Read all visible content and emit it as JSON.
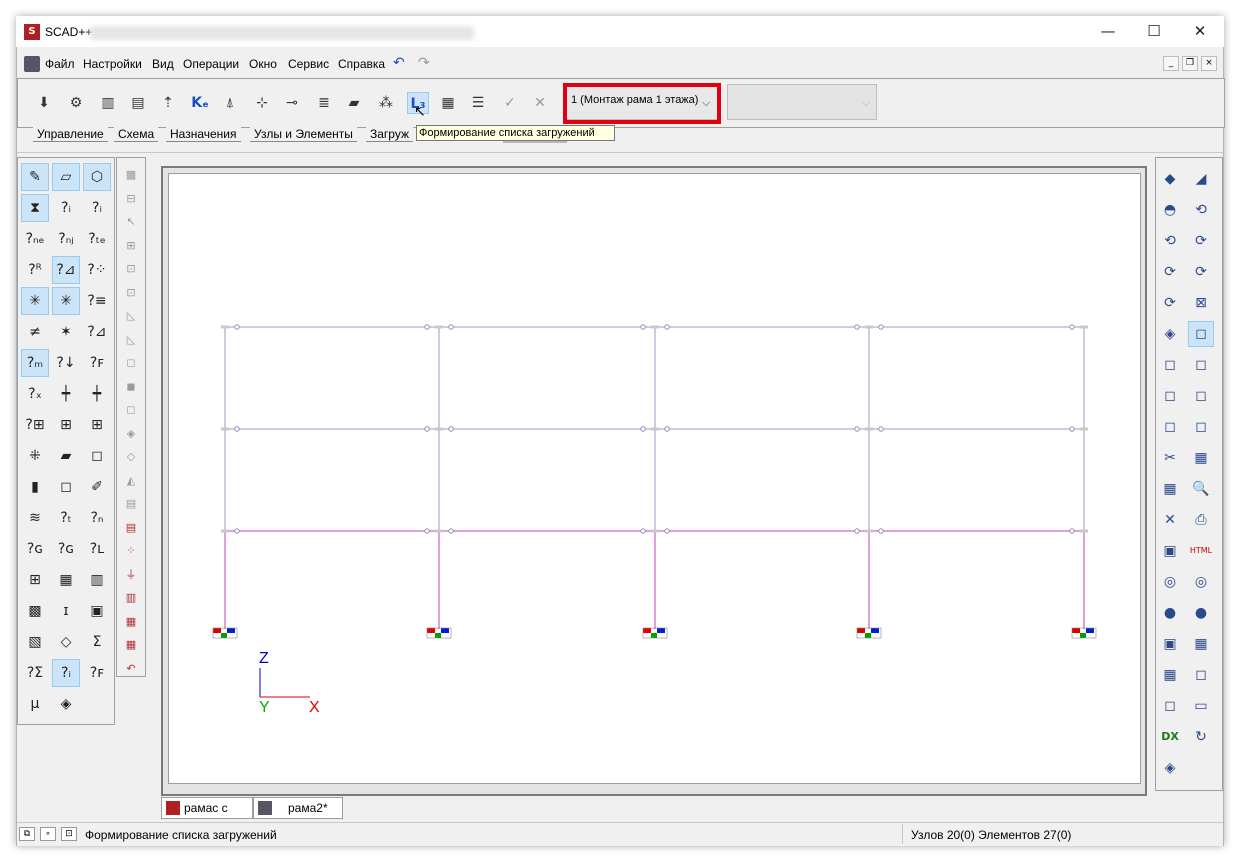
{
  "window": {
    "title": "SCAD++",
    "minimize_glyph": "—",
    "maximize_glyph": "☐",
    "close_glyph": "✕"
  },
  "menu": {
    "items": [
      "Файл",
      "Настройки",
      "Вид",
      "Операции",
      "Окно",
      "Сервис",
      "Справка"
    ],
    "undo_glyph": "↶",
    "redo_glyph": "↷",
    "mdi_minimize": "_",
    "mdi_restore": "❐",
    "mdi_close": "×"
  },
  "toolbar": {
    "load_case_combo_value": "1 (Монтаж рама 1 этажа)",
    "second_combo_value": "",
    "buttons": [
      {
        "name": "load-nodes-icon",
        "glyph": "⬇"
      },
      {
        "name": "settings-icon",
        "glyph": "⚙"
      },
      {
        "name": "load-column-icon",
        "glyph": "▥"
      },
      {
        "name": "load-frame-icon",
        "glyph": "▤"
      },
      {
        "name": "load-up-icon",
        "glyph": "⇡"
      },
      {
        "name": "ke-icon",
        "glyph": "Kₑ"
      },
      {
        "name": "support-icon",
        "glyph": "⍋"
      },
      {
        "name": "node-insert-icon",
        "glyph": "⊹"
      },
      {
        "name": "node-split-icon",
        "glyph": "⊸"
      },
      {
        "name": "layers-icon",
        "glyph": "≣"
      },
      {
        "name": "yellow-load-icon",
        "glyph": "▰"
      },
      {
        "name": "nodes-scatter-icon",
        "glyph": "⁂"
      },
      {
        "name": "load-list-icon",
        "glyph": "L₃"
      },
      {
        "name": "load-combination-icon",
        "glyph": "▦"
      },
      {
        "name": "properties-list-icon",
        "glyph": "☰"
      },
      {
        "name": "apply-check-icon",
        "glyph": "✓"
      },
      {
        "name": "cancel-x-icon",
        "glyph": "✕"
      }
    ]
  },
  "tabs": [
    "Управление",
    "Схема",
    "Назначения",
    "Узлы и Элементы",
    "Загруж"
  ],
  "tooltip": "Формирование списка загружений",
  "left_panel": {
    "glyphs": [
      "✎",
      "▱",
      "⬡",
      "⧗",
      "?ᵢ",
      "?ᵢ",
      "?ₙₑ",
      "?ₙⱼ",
      "?ₜₑ",
      "?ᴿ",
      "?⊿",
      "?⁘",
      "✳",
      "✳",
      "?≡",
      "≠",
      "✶",
      "?⊿",
      "?ₘ",
      "?↓",
      "?ꜰ",
      "?ₓ",
      "┿",
      "┿",
      "?⊞",
      "⊞",
      "⊞",
      "⁜",
      "▰",
      "◻",
      "▮",
      "◻",
      "✐",
      "≋",
      "?ₜ",
      "?ₙ",
      "?ɢ",
      "?ɢ",
      "?ʟ",
      "⊞",
      "▦",
      "▥",
      "▩",
      "ɪ",
      "▣",
      "▧",
      "◇",
      "Σ",
      "?Σ",
      "?ᵢ",
      "?ꜰ",
      "μ",
      "◈"
    ]
  },
  "left_panel2": {
    "glyphs": [
      "▩",
      "⊟",
      "↖",
      "⊞",
      "⊡",
      "⊡",
      "◺",
      "◺",
      "◻",
      "◼",
      "◻",
      "◈",
      "◇",
      "◭",
      "▤",
      "▤",
      "⁘",
      "⏚",
      "▥",
      "▦",
      "▦",
      "↶"
    ]
  },
  "right_panel": {
    "glyphs": [
      "◆",
      "◢",
      "◓",
      "⟲",
      "⟲",
      "⟳",
      "⟳",
      "⟳",
      "⟳",
      "⊠",
      "◈",
      "◻",
      "◻",
      "◻",
      "◻",
      "◻",
      "◻",
      "◻",
      "✂",
      "▦",
      "▦",
      "🔍",
      "✕",
      "⎙",
      "▣",
      "HTML",
      "◎",
      "◎",
      "●",
      "●",
      "▣",
      "▦",
      "▦",
      "◻",
      "◻",
      "▭",
      "DX",
      "↻",
      "◈"
    ]
  },
  "canvas": {
    "axis_z": "Z",
    "axis_y": "Y",
    "axis_x": "X"
  },
  "doc_tabs": [
    "рамас с же...",
    "рама2*"
  ],
  "status": {
    "message": "Формирование списка загружений",
    "counts": "Узлов 20(0) Элементов 27(0)"
  },
  "colors": {
    "frame_top": "#9a9ac8",
    "frame_bottom": "#c040c0",
    "support_red": "#e00000",
    "support_blue": "#0020d0",
    "support_green": "#00a000",
    "axis_z": "#0000d0",
    "axis_y": "#00b000",
    "axis_x": "#e00000",
    "highlight_red": "#e0000f"
  }
}
